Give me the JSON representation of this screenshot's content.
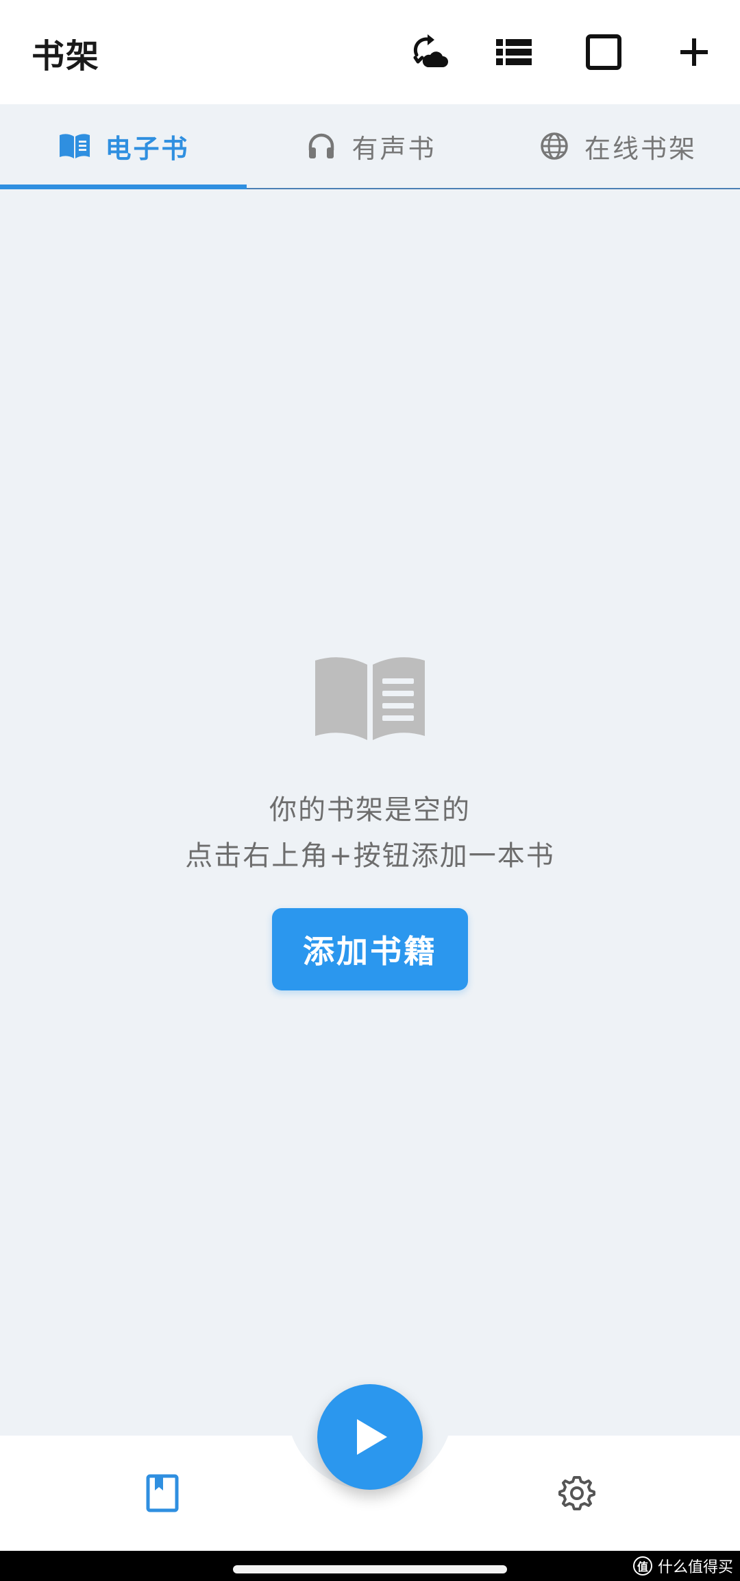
{
  "appbar": {
    "title": "书架",
    "actions": [
      {
        "icon": "cloud-sync-icon"
      },
      {
        "icon": "list-view-icon"
      },
      {
        "icon": "select-square-icon"
      },
      {
        "icon": "plus-icon"
      }
    ]
  },
  "tabs": [
    {
      "label": "电子书",
      "icon": "book-open-icon",
      "active": true
    },
    {
      "label": "有声书",
      "icon": "headphones-icon",
      "active": false
    },
    {
      "label": "在线书架",
      "icon": "globe-icon",
      "active": false
    }
  ],
  "empty_state": {
    "icon": "book-open-icon",
    "line1": "你的书架是空的",
    "line2": "点击右上角+按钮添加一本书",
    "button_label": "添加书籍"
  },
  "bottom_nav": {
    "items": [
      {
        "icon": "bookshelf-icon",
        "active": true
      },
      {
        "icon": "play-icon"
      },
      {
        "icon": "settings-gear-icon"
      }
    ]
  },
  "watermark": {
    "text": "什么值得买",
    "badge": "值"
  },
  "colors": {
    "accent": "#2b97ee",
    "tab_active": "#2f8fe0",
    "background": "#eef2f6",
    "inactive_icon": "#bdbdbd"
  }
}
